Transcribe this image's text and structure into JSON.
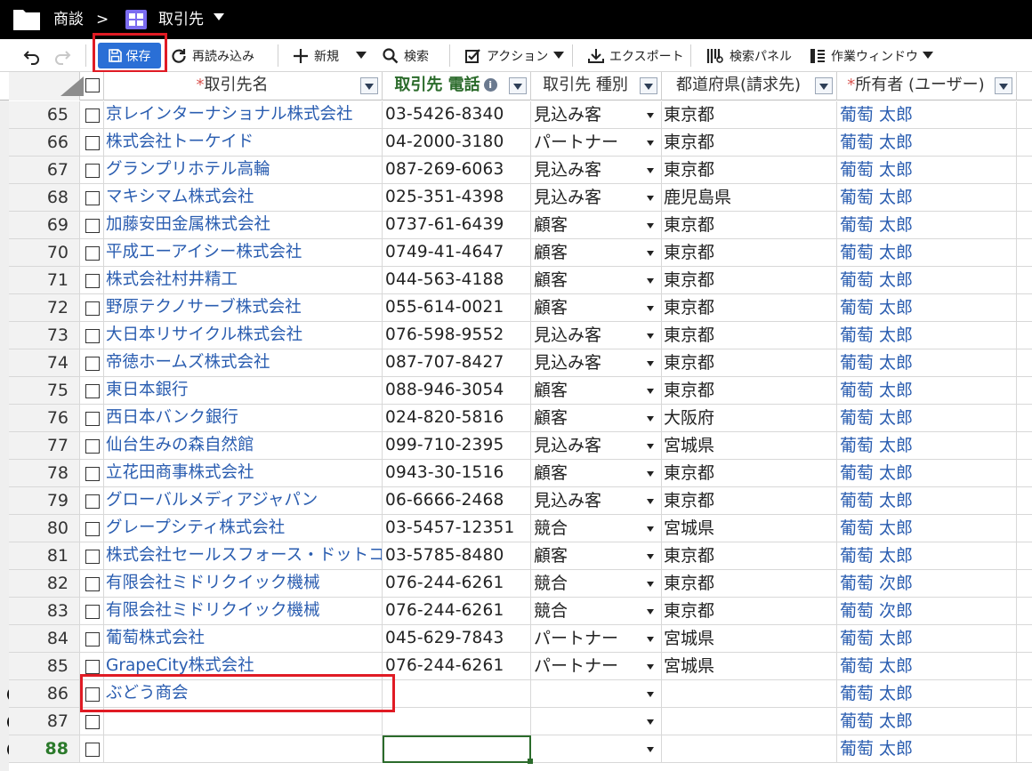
{
  "breadcrumb": {
    "object": "商談",
    "separator": ">",
    "current": "取引先"
  },
  "toolbar": {
    "save": "保存",
    "reload": "再読み込み",
    "new": "新規",
    "search": "検索",
    "action": "アクション",
    "export": "エクスポート",
    "search_panel": "検索パネル",
    "work_window": "作業ウィンドウ"
  },
  "columns": {
    "name": "取引先名",
    "phone": "取引先 電話",
    "type": "取引先 種別",
    "prefecture": "都道府県(請求先)",
    "owner": "所有者 (ユーザー)"
  },
  "rows": [
    {
      "num": "65",
      "name": "京レインターナショナル株式会社",
      "phone": "03-5426-8340",
      "type": "見込み客",
      "pref": "東京都",
      "owner": "葡萄 太郎"
    },
    {
      "num": "66",
      "name": "株式会社トーケイド",
      "phone": "04-2000-3180",
      "type": "パートナー",
      "pref": "東京都",
      "owner": "葡萄 太郎"
    },
    {
      "num": "67",
      "name": "グランプリホテル高輪",
      "phone": "087-269-6063",
      "type": "見込み客",
      "pref": "東京都",
      "owner": "葡萄 太郎"
    },
    {
      "num": "68",
      "name": "マキシマム株式会社",
      "phone": "025-351-4398",
      "type": "見込み客",
      "pref": "鹿児島県",
      "owner": "葡萄 太郎"
    },
    {
      "num": "69",
      "name": "加藤安田金属株式会社",
      "phone": "0737-61-6439",
      "type": "顧客",
      "pref": "東京都",
      "owner": "葡萄 太郎"
    },
    {
      "num": "70",
      "name": "平成エーアイシー株式会社",
      "phone": "0749-41-4647",
      "type": "顧客",
      "pref": "東京都",
      "owner": "葡萄 太郎"
    },
    {
      "num": "71",
      "name": "株式会社村井精工",
      "phone": "044-563-4188",
      "type": "顧客",
      "pref": "東京都",
      "owner": "葡萄 太郎"
    },
    {
      "num": "72",
      "name": "野原テクノサーブ株式会社",
      "phone": "055-614-0021",
      "type": "顧客",
      "pref": "東京都",
      "owner": "葡萄 太郎"
    },
    {
      "num": "73",
      "name": "大日本リサイクル株式会社",
      "phone": "076-598-9552",
      "type": "見込み客",
      "pref": "東京都",
      "owner": "葡萄 太郎"
    },
    {
      "num": "74",
      "name": "帝徳ホームズ株式会社",
      "phone": "087-707-8427",
      "type": "見込み客",
      "pref": "東京都",
      "owner": "葡萄 太郎"
    },
    {
      "num": "75",
      "name": "東日本銀行",
      "phone": "088-946-3054",
      "type": "顧客",
      "pref": "東京都",
      "owner": "葡萄 太郎"
    },
    {
      "num": "76",
      "name": "西日本バンク銀行",
      "phone": "024-820-5816",
      "type": "顧客",
      "pref": "大阪府",
      "owner": "葡萄 太郎"
    },
    {
      "num": "77",
      "name": "仙台生みの森自然館",
      "phone": "099-710-2395",
      "type": "見込み客",
      "pref": "宮城県",
      "owner": "葡萄 太郎"
    },
    {
      "num": "78",
      "name": "立花田商事株式会社",
      "phone": "0943-30-1516",
      "type": "顧客",
      "pref": "東京都",
      "owner": "葡萄 太郎"
    },
    {
      "num": "79",
      "name": "グローバルメディアジャパン",
      "phone": "06-6666-2468",
      "type": "見込み客",
      "pref": "東京都",
      "owner": "葡萄 太郎"
    },
    {
      "num": "80",
      "name": "グレープシティ株式会社",
      "phone": "03-5457-12351",
      "type": "競合",
      "pref": "宮城県",
      "owner": "葡萄 太郎"
    },
    {
      "num": "81",
      "name": "株式会社セールスフォース・ドットコム",
      "phone": "03-5785-8480",
      "type": "顧客",
      "pref": "東京都",
      "owner": "葡萄 太郎"
    },
    {
      "num": "82",
      "name": "有限会社ミドリクイック機械",
      "phone": "076-244-6261",
      "type": "競合",
      "pref": "東京都",
      "owner": "葡萄 次郎"
    },
    {
      "num": "83",
      "name": "有限会社ミドリクイック機械",
      "phone": "076-244-6261",
      "type": "競合",
      "pref": "東京都",
      "owner": "葡萄 次郎"
    },
    {
      "num": "84",
      "name": "葡萄株式会社",
      "phone": "045-629-7843",
      "type": "パートナー",
      "pref": "宮城県",
      "owner": "葡萄 太郎"
    },
    {
      "num": "85",
      "name": "GrapeCity株式会社",
      "phone": "076-244-6261",
      "type": "パートナー",
      "pref": "宮城県",
      "owner": "葡萄 太郎"
    },
    {
      "num": "86",
      "name": "ぶどう商会",
      "phone": "",
      "type": "",
      "pref": "",
      "owner": "葡萄 太郎",
      "new": true
    },
    {
      "num": "87",
      "name": "",
      "phone": "",
      "type": "",
      "pref": "",
      "owner": "葡萄 太郎",
      "new": true
    },
    {
      "num": "88",
      "name": "",
      "phone": "",
      "type": "",
      "pref": "",
      "owner": "葡萄 太郎",
      "new": true,
      "current": true
    }
  ]
}
